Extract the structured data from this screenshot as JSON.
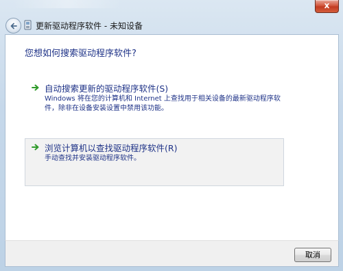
{
  "window": {
    "title": "更新驱动程序软件 - 未知设备",
    "close_glyph": "x"
  },
  "heading": "您想如何搜索驱动程序软件?",
  "options": [
    {
      "title": "自动搜索更新的驱动程序软件(S)",
      "description": "Windows 将在您的计算机和 Internet 上查找用于相关设备的最新驱动程序软件，除非在设备安装设置中禁用该功能。"
    },
    {
      "title": "浏览计算机以查找驱动程序软件(R)",
      "description": "手动查找并安装驱动程序软件。"
    }
  ],
  "footer": {
    "cancel_label": "取消"
  },
  "colors": {
    "link_blue": "#1e3287",
    "arrow_green": "#2f9a2a"
  }
}
